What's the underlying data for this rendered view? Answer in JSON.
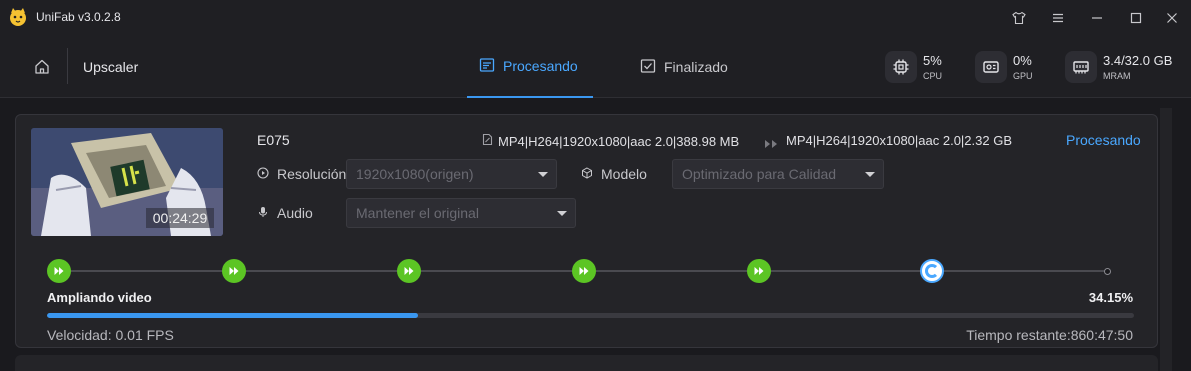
{
  "app": {
    "title": "UniFab v3.0.2.8"
  },
  "header": {
    "breadcrumb": "Upscaler",
    "tabs": [
      {
        "label": "Procesando",
        "active": true
      },
      {
        "label": "Finalizado",
        "active": false
      }
    ],
    "stats": {
      "cpu": {
        "value": "5%",
        "label": "CPU"
      },
      "gpu": {
        "value": "0%",
        "label": "GPU"
      },
      "mram": {
        "value": "3.4/32.0 GB",
        "label": "MRAM"
      }
    }
  },
  "task": {
    "name": "E075",
    "duration": "00:24:29",
    "source_info": "MP4|H264|1920x1080|aac 2.0|388.98 MB",
    "output_info": "MP4|H264|1920x1080|aac 2.0|2.32 GB",
    "status": "Procesando",
    "resolution": {
      "label": "Resolución",
      "value": "1920x1080(origen)"
    },
    "model": {
      "label": "Modelo",
      "value": "Optimizado para Calidad"
    },
    "audio": {
      "label": "Audio",
      "value": "Mantener el original"
    },
    "phase": "Ampliando video",
    "percent_text": "34.15%",
    "progress_fraction": 0.3415,
    "speed": "Velocidad: 0.01  FPS",
    "remaining": "Tiempo restante:860:47:50",
    "steps_completed": 5
  },
  "colors": {
    "accent": "#3a97f0",
    "step_done": "#5cc524",
    "background": "#1a1a1e"
  },
  "icons": [
    "app-logo-icon",
    "tshirt-icon",
    "menu-icon",
    "minimize-icon",
    "maximize-icon",
    "close-icon",
    "home-icon",
    "list-icon",
    "checkbox-icon",
    "cpu-icon",
    "gpu-icon",
    "memory-icon",
    "file-icon",
    "arrow-right-icon",
    "play-circle-icon",
    "cube-icon",
    "microphone-icon",
    "fast-forward-icon"
  ]
}
